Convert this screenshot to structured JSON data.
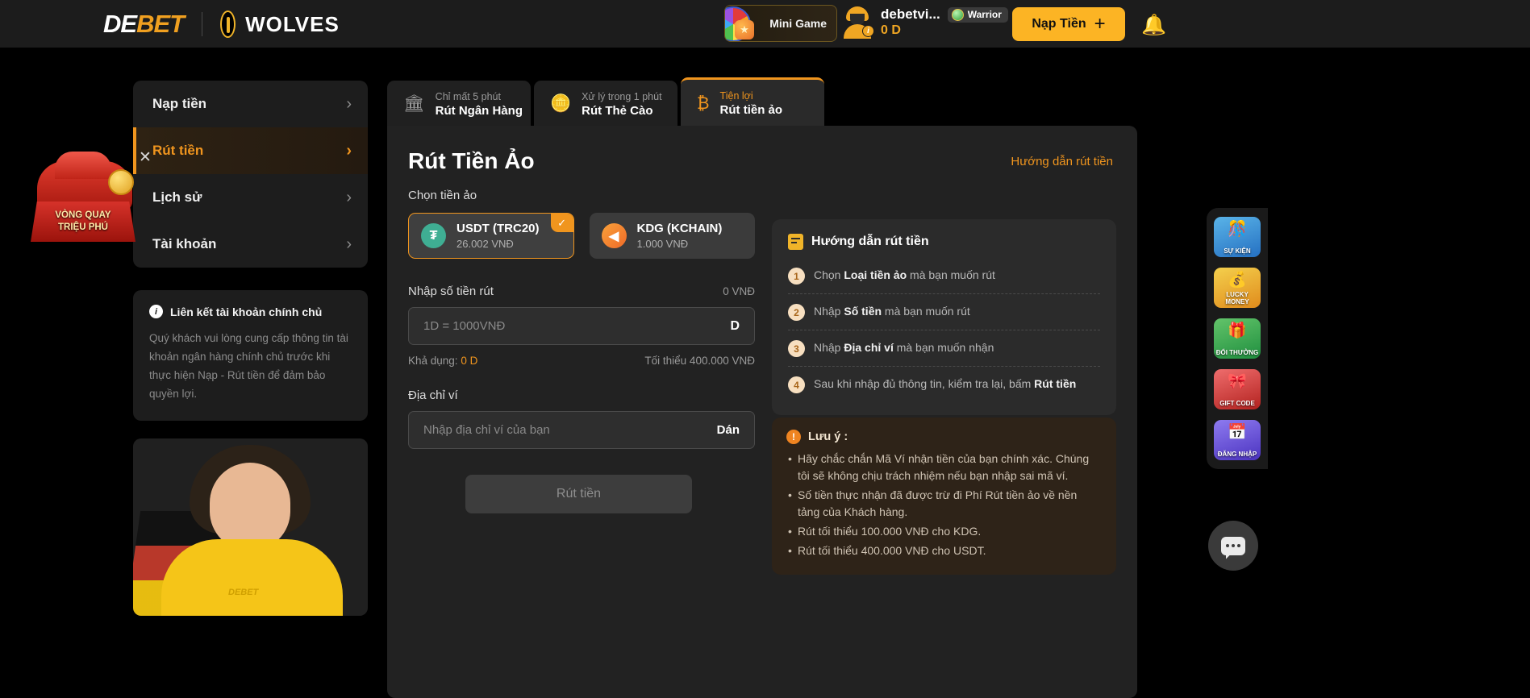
{
  "header": {
    "logo_primary": "DE",
    "logo_secondary": "BET",
    "partner": "WOLVES",
    "minigame_label": "Mini Game",
    "username": "debetvi...",
    "rank": "Warrior",
    "balance": "0 D",
    "deposit_label": "Nạp Tiền",
    "plus": "+",
    "bell": "🔔"
  },
  "sidebar": {
    "items": [
      {
        "label": "Nạp tiền",
        "chevron": "›",
        "active": false
      },
      {
        "label": "Rút tiền",
        "chevron": "›",
        "active": true
      },
      {
        "label": "Lịch sử",
        "chevron": "›",
        "active": false
      },
      {
        "label": "Tài khoản",
        "chevron": "›",
        "active": false
      }
    ],
    "info": {
      "icon": "i",
      "title": "Liên kết tài khoản chính chủ",
      "body": "Quý khách vui lòng cung cấp thông tin tài khoản ngân hàng chính chủ trước khi thực hiện Nạp - Rút tiền để đảm bảo quyền lợi."
    }
  },
  "promo": {
    "close": "✕",
    "line1": "VÒNG QUAY",
    "line2": "TRIỆU PHÚ",
    "agent_badge": "DEBET"
  },
  "tabs": [
    {
      "sub": "Chỉ mất 5 phút",
      "main": "Rút Ngân Hàng",
      "icon": "🏛",
      "active": false
    },
    {
      "sub": "Xử lý trong 1 phút",
      "main": "Rút Thẻ Cào",
      "icon": "🪙",
      "active": false
    },
    {
      "sub": "Tiện lợi",
      "main": "Rút tiền ảo",
      "icon": "₿",
      "active": true
    }
  ],
  "main": {
    "title": "Rút Tiền Ảo",
    "guide_link": "Hướng dẫn rút tiền",
    "choose_coin_label": "Chọn tiền ảo",
    "coins": [
      {
        "symbol": "₮",
        "name": "USDT (TRC20)",
        "rate": "26.002 VNĐ",
        "selected": true,
        "check": "✓"
      },
      {
        "symbol": "◀",
        "name": "KDG (KCHAIN)",
        "rate": "1.000 VNĐ",
        "selected": false,
        "check": ""
      }
    ],
    "amount_label": "Nhập số tiền rút",
    "amount_value_right": "0 VNĐ",
    "amount_placeholder": "1D = 1000VNĐ",
    "amount_value": "",
    "amount_suffix": "D",
    "available_prefix": "Khả dụng: ",
    "available_value": "0 D",
    "minimum_text": "Tối thiểu 400.000 VNĐ",
    "wallet_label": "Địa chỉ ví",
    "wallet_placeholder": "Nhập địa chỉ ví của bạn",
    "wallet_value": "",
    "paste_label": "Dán",
    "submit_label": "Rút tiền"
  },
  "guide": {
    "title": "Hướng dẫn rút tiền",
    "steps": [
      {
        "num": "1",
        "pre": "Chọn ",
        "bold": "Loại tiền ảo",
        "post": " mà bạn muốn rút"
      },
      {
        "num": "2",
        "pre": "Nhập ",
        "bold": "Số tiền",
        "post": " mà bạn muốn rút"
      },
      {
        "num": "3",
        "pre": "Nhập ",
        "bold": "Địa chỉ ví",
        "post": " mà bạn muốn nhận"
      },
      {
        "num": "4",
        "pre": "Sau khi nhập đủ thông tin, kiểm tra lại, bấm ",
        "bold": "Rút tiền",
        "post": ""
      }
    ]
  },
  "note": {
    "icon": "!",
    "title": "Lưu ý :",
    "items": [
      "Hãy chắc chắn Mã Ví nhận tiền của bạn chính xác. Chúng tôi sẽ không chịu trách nhiệm nếu bạn nhập sai mã ví.",
      "Số tiền thực nhận đã được trừ đi Phí Rút tiền ảo về nền tảng của Khách hàng.",
      "Rút tối thiểu 100.000 VNĐ cho KDG.",
      "Rút tối thiểu 400.000 VNĐ cho USDT."
    ]
  },
  "rail": [
    {
      "caption": "SỰ KIỆN",
      "glyph": "🎊"
    },
    {
      "caption": "LUCKY MONEY",
      "glyph": "💰"
    },
    {
      "caption": "ĐỔI THƯỞNG",
      "glyph": "🎁"
    },
    {
      "caption": "GIFT CODE",
      "glyph": "🎀"
    },
    {
      "caption": "ĐĂNG NHẬP",
      "glyph": "📅"
    }
  ],
  "colors": {
    "accent": "#f0951e",
    "deposit_bg": "#fcb424",
    "panel_bg": "#222222",
    "page_bg": "#000000"
  }
}
